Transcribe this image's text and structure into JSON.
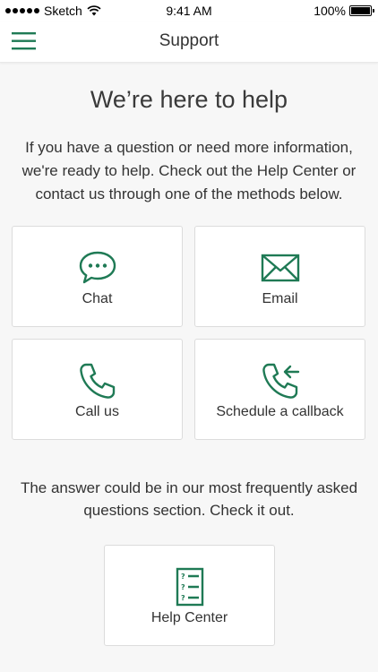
{
  "status_bar": {
    "carrier": "Sketch",
    "time": "9:41 AM",
    "battery": "100%"
  },
  "nav": {
    "title": "Support",
    "menu_icon": "hamburger-menu-icon"
  },
  "content": {
    "heading": "We’re here to help",
    "intro": "If you have a question or need more information, we're ready to help. Check out the Help Center or contact us through one of the methods below.",
    "contact_options": [
      {
        "label": "Chat",
        "icon": "chat-bubble-icon"
      },
      {
        "label": "Email",
        "icon": "envelope-icon"
      },
      {
        "label": "Call us",
        "icon": "phone-icon"
      },
      {
        "label": "Schedule a callback",
        "icon": "phone-callback-icon"
      }
    ],
    "faq_text": "The answer could be in our most frequently asked questions section. Check it out.",
    "help_center": {
      "label": "Help Center",
      "icon": "faq-list-icon"
    }
  },
  "colors": {
    "accent": "#1f7a55",
    "background": "#f7f7f7",
    "card": "#ffffff",
    "text": "#333333"
  }
}
